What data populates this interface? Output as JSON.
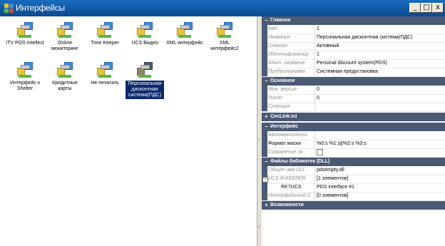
{
  "window": {
    "title": "Интерфейсы",
    "buttons": {
      "minimize": "_",
      "restore": "□",
      "close": "x"
    }
  },
  "icons": [
    {
      "label": "ITV POS Intellect"
    },
    {
      "label": "Online мониторинг"
    },
    {
      "label": "Time Keeper"
    },
    {
      "label": "UCS Видео"
    },
    {
      "label": "XML интерфейс"
    },
    {
      "label": "XML интерфейс2"
    },
    {
      "label": "Интерфейс к Shelter"
    },
    {
      "label": "Кредитные карты"
    },
    {
      "label": "Не печатать"
    },
    {
      "label": "Персональная дисконтная система(ПДС)"
    }
  ],
  "selected_icon_index": 9,
  "properties": {
    "cat_main": {
      "sign": "−",
      "label": "Главное"
    },
    "main_rows": [
      {
        "name": "Код",
        "value": "1"
      },
      {
        "name": "Название",
        "value": "Персональная дисконтная система(ПДС)"
      },
      {
        "name": "Статус",
        "value": "Активный"
      },
      {
        "name": "Идентификатор",
        "value": "1"
      },
      {
        "name": "Альт. название",
        "value": "Personal discount system(PDS)"
      },
      {
        "name": "Предустановка",
        "value": "Системная предустановка"
      }
    ],
    "cat_basic": {
      "sign": "−",
      "label": "Основное"
    },
    "basic_rows": [
      {
        "name": "Мин. версия",
        "value": "0"
      },
      {
        "name": "Число",
        "value": "0"
      },
      {
        "name": "Станция",
        "value": ""
      }
    ],
    "cat_cec": {
      "sign": "+",
      "label": "CecLink.ini"
    },
    "cat_iface": {
      "sign": "−",
      "label": "Интерфейс"
    },
    "iface_rows": [
      {
        "name": "Автоматически",
        "value": ""
      },
      {
        "name": "Формат маски",
        "value": "%0:s %1:s||%2:s %3:s"
      },
      {
        "name": "Сохранение за",
        "value": ""
      }
    ],
    "cat_libs": {
      "sign": "−",
      "label": "Файлы библиотек (DLL)"
    },
    "lib_rows": [
      {
        "name": "Общее имя DLL",
        "value": "pdsempty.dll"
      },
      {
        "name": "UCS R-KEEPER",
        "value": "[1 элементов]"
      },
      {
        "name": "RK7UCS",
        "value": "PDS interface #1"
      },
      {
        "name": "Интерфейсный С",
        "value": "[0 элементов]"
      }
    ],
    "cat_caps": {
      "sign": "+",
      "label": "Возможности"
    }
  },
  "colors": {
    "title_bar": "#0f56a3",
    "category": "#4b5a73",
    "selected": "#0b2a6e"
  }
}
